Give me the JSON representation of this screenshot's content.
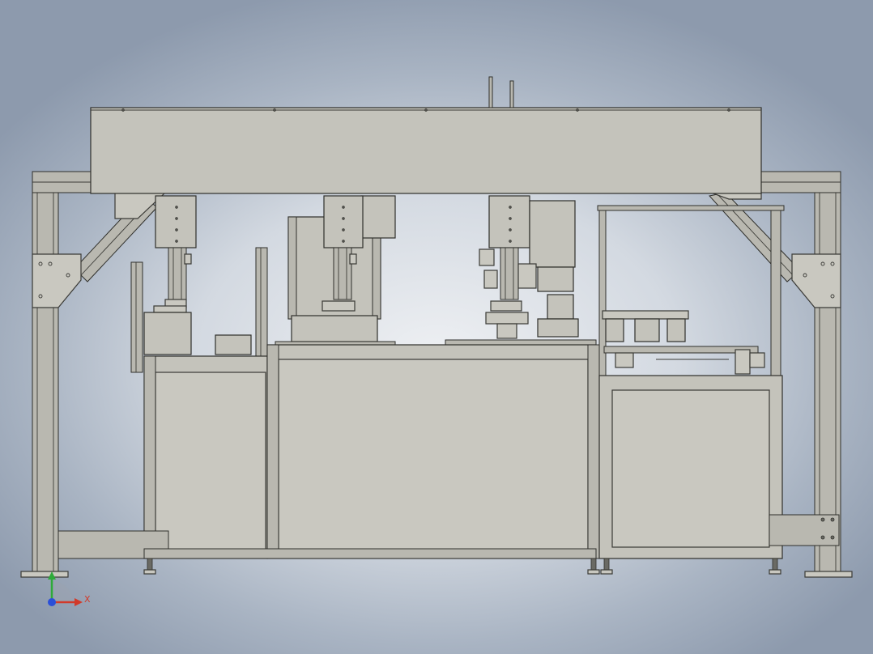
{
  "viewport": {
    "background_top": "#8d9aad",
    "background_center": "#eef0f3"
  },
  "model": {
    "part_color": "#c9c8c0",
    "edge_color": "#2f2f2b"
  },
  "triad": {
    "x_label": "X",
    "x_color": "#d23a2a",
    "y_color": "#2eaa3a",
    "z_color": "#2a4fd8"
  }
}
